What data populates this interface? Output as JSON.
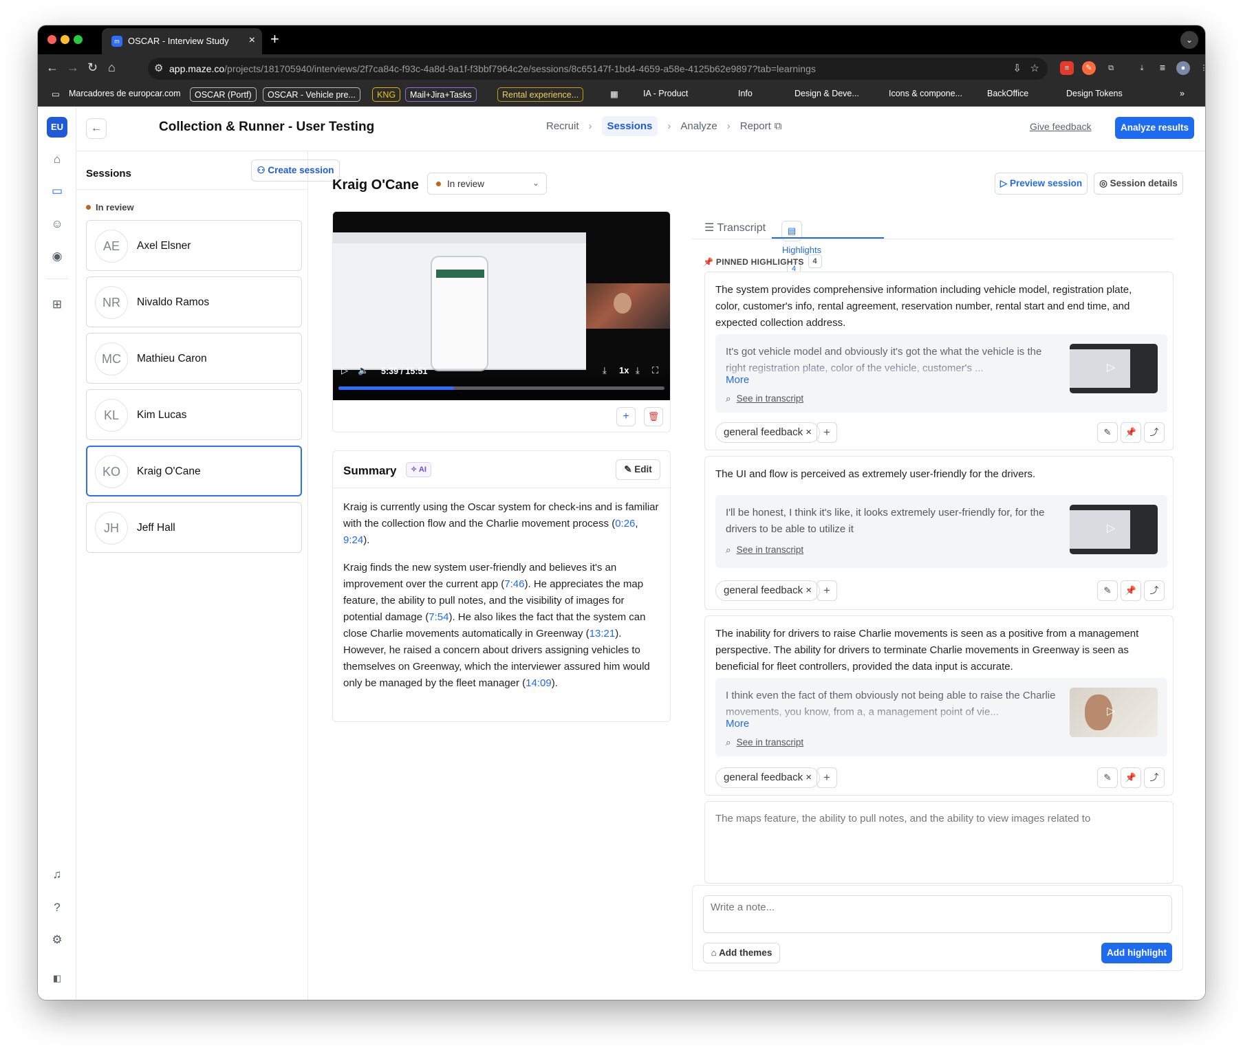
{
  "browser": {
    "tab_title": "OSCAR - Interview Study",
    "url_host": "app.maze.co",
    "url_path": "/projects/181705940/interviews/2f7ca84c-f93c-4a8d-9a1f-f3bbf7964c2e/sessions/8c65147f-1bd4-4659-a58e-4125b62e9897?tab=learnings",
    "bookmarks": [
      "Marcadores de europcar.com",
      "OSCAR (Portf)",
      "OSCAR - Vehicle pre...",
      "KNG",
      "Mail+Jira+Tasks",
      "Rental experience...",
      "IA - Product",
      "Info",
      "Design & Deve...",
      "Icons & compone...",
      "BackOffice",
      "Design Tokens"
    ]
  },
  "workspace_avatar": "EU",
  "header": {
    "title": "Collection & Runner - User Testing",
    "steps": [
      "Recruit",
      "Sessions",
      "Analyze",
      "Report"
    ],
    "give_feedback": "Give feedback",
    "analyze_results": "Analyze results"
  },
  "sessions": {
    "title": "Sessions",
    "create": "Create session",
    "status_group": "In review",
    "items": [
      {
        "initials": "AE",
        "name": "Axel Elsner"
      },
      {
        "initials": "NR",
        "name": "Nivaldo Ramos"
      },
      {
        "initials": "MC",
        "name": "Mathieu Caron"
      },
      {
        "initials": "KL",
        "name": "Kim Lucas"
      },
      {
        "initials": "KO",
        "name": "Kraig O'Cane"
      },
      {
        "initials": "JH",
        "name": "Jeff Hall"
      }
    ],
    "selected": "Kraig O'Cane"
  },
  "session": {
    "name": "Kraig O'Cane",
    "status": "In review",
    "preview": "Preview session",
    "details": "Session details"
  },
  "video": {
    "time": "5:39 / 15:51",
    "speed": "1x",
    "progress": 0.355
  },
  "summary": {
    "title": "Summary",
    "ai": "AI",
    "edit": "Edit",
    "p1_a": "Kraig is currently using the Oscar system for check-ins and is familiar with the collection flow and the Charlie movement process (",
    "p1_t1": "0:26",
    "p1_b": ", ",
    "p1_t2": "9:24",
    "p1_c": ").",
    "p2_a": "Kraig finds the new system user-friendly and believes it's an improvement over the current app (",
    "p2_t1": "7:46",
    "p2_b": "). He appreciates the map feature, the ability to pull notes, and the visibility of images for potential damage (",
    "p2_t2": "7:54",
    "p2_c": "). He also likes the fact that the system can close Charlie movements automatically in Greenway (",
    "p2_t3": "13:21",
    "p2_d": "). However, he raised a concern about drivers assigning vehicles to themselves on Greenway, which the interviewer assured him would only be managed by the fleet manager (",
    "p2_t4": "14:09",
    "p2_e": ")."
  },
  "tabs": {
    "transcript": "Transcript",
    "highlights": "Highlights",
    "highlights_count": "4"
  },
  "pinned": {
    "label": "PINNED HIGHLIGHTS",
    "count": "4"
  },
  "highlights": [
    {
      "summary": "The system provides comprehensive information including vehicle model, registration plate, color, customer's info, rental agreement, reservation number, rental start and end time, and expected collection address.",
      "quote": "It's got vehicle model and obviously it's got the what the vehicle is the right registration plate, color of the vehicle, customer's ...",
      "more": "More",
      "see": "See in transcript",
      "tag": "general feedback"
    },
    {
      "summary": "The UI and flow is perceived as extremely user-friendly for the drivers.",
      "quote": "I'll be honest, I think it's like, it looks extremely user-friendly for, for the drivers to be able to utilize it",
      "see": "See in transcript",
      "tag": "general feedback"
    },
    {
      "summary": "The inability for drivers to raise Charlie movements is seen as a positive from a management perspective. The ability for drivers to terminate Charlie movements in Greenway is seen as beneficial for fleet controllers, provided the data input is accurate.",
      "quote": "I think even the fact of them obviously not being able to raise the Charlie movements, you know, from a, a management point of vie...",
      "more": "More",
      "see": "See in transcript",
      "tag": "general feedback"
    },
    {
      "summary": "The maps feature, the ability to pull notes, and the ability to view images related to"
    }
  ],
  "note": {
    "placeholder": "Write a note...",
    "add_themes": "Add themes",
    "add_highlight": "Add highlight"
  }
}
